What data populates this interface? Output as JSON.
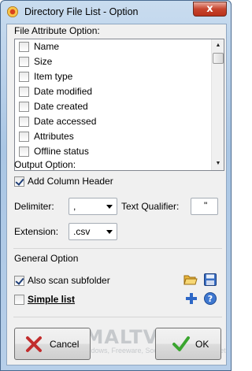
{
  "window": {
    "title": "Directory File List - Option",
    "close_label": "x"
  },
  "file_attribute": {
    "heading": "File Attribute Option:",
    "items": [
      {
        "label": "Name",
        "checked": false
      },
      {
        "label": "Size",
        "checked": false
      },
      {
        "label": "Item type",
        "checked": false
      },
      {
        "label": "Date modified",
        "checked": false
      },
      {
        "label": "Date created",
        "checked": false
      },
      {
        "label": "Date accessed",
        "checked": false
      },
      {
        "label": "Attributes",
        "checked": false
      },
      {
        "label": "Offline status",
        "checked": false
      }
    ]
  },
  "output": {
    "heading": "Output Option:",
    "add_column_header": {
      "label": "Add Column Header",
      "checked": true
    },
    "delimiter_label": "Delimiter:",
    "delimiter_value": ",",
    "text_qualifier_label": "Text Qualifier:",
    "text_qualifier_value": "\"",
    "extension_label": "Extension:",
    "extension_value": ".csv"
  },
  "general": {
    "heading": "General Option",
    "also_scan": {
      "label": "Also scan subfolder",
      "checked": true
    },
    "simple_list": {
      "label": "Simple list",
      "checked": false
    }
  },
  "buttons": {
    "cancel_label": "Cancel",
    "ok_label": "OK"
  },
  "watermark": {
    "main": "NIRMALTV.COM",
    "sub": "Tech Tips, Windows, Freeware, Social Media and Internet"
  },
  "colors": {
    "link_blue": "#1c5aa8",
    "cancel_red": "#c22d2d",
    "ok_green": "#3aa52f"
  }
}
